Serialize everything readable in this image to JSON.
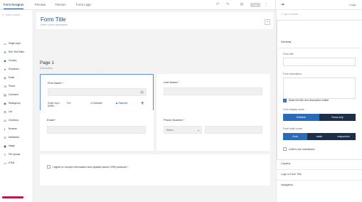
{
  "tabs": [
    {
      "label": "Form Designer",
      "active": true
    },
    {
      "label": "Preview",
      "active": false
    },
    {
      "label": "Themes",
      "active": false
    },
    {
      "label": "Form Logic",
      "active": false
    }
  ],
  "topbar": {
    "undo_icon": "undo-icon",
    "redo_icon": "redo-icon",
    "settings_icon": "gear-icon",
    "save_label": "Save",
    "collapse_icon": "collapse-icon",
    "right_label": "Logic"
  },
  "toolbox": {
    "search_placeholder": "Type to search...",
    "items": [
      {
        "label": "Single-Input",
        "icon": "textbox-icon"
      },
      {
        "label": "Rich Text Editor",
        "icon": "richtext-icon"
      },
      {
        "label": "Country",
        "icon": "globe-icon"
      },
      {
        "label": "Dropdown",
        "icon": "dropdown-icon"
      },
      {
        "label": "Email",
        "icon": "email-icon"
      },
      {
        "label": "Phone",
        "icon": "phone-icon"
      },
      {
        "label": "Comment",
        "icon": "comment-icon"
      },
      {
        "label": "Radiogroup",
        "icon": "radio-icon"
      },
      {
        "label": "List",
        "icon": "list-icon"
      },
      {
        "label": "Checkbox",
        "icon": "checkbox-icon"
      },
      {
        "label": "Boolean",
        "icon": "toggle-icon"
      },
      {
        "label": "Multiselect",
        "icon": "multiselect-icon"
      },
      {
        "label": "Image",
        "icon": "image-icon"
      },
      {
        "label": "File Upload",
        "icon": "upload-icon"
      },
      {
        "label": "HTML",
        "icon": "code-icon"
      }
    ]
  },
  "form": {
    "title": "Form Title",
    "description": "Enter a form description",
    "page_title": "Page 1",
    "page_description": "Description"
  },
  "questions": {
    "first_name": {
      "label": "First Name",
      "required_mark": "*",
      "footer_type": "Single Input",
      "footer_subtype": "Text",
      "duplicate": "Duplicate",
      "required": "Required",
      "delete": "Delete"
    },
    "last_name": {
      "label": "Last Name",
      "required_mark": "*"
    },
    "email": {
      "label": "Email",
      "required_mark": "*"
    },
    "phone": {
      "label": "Phone Number",
      "required_mark": "*",
      "select_placeholder": "Select..."
    },
    "consent": {
      "label": "I agree to receive information and updates about CRM products",
      "required_mark": "*"
    }
  },
  "panel": {
    "search_placeholder": "Type to search...",
    "section_general": "General",
    "form_title_label": "Form title",
    "form_description_label": "Form description",
    "title_visible_label": "Make the title and description visible",
    "display_mode_label": "Form display mode",
    "display_mode_options": [
      "Editable",
      "Read-only"
    ],
    "display_mode_selected": "Editable",
    "width_mode_label": "Form width mode",
    "width_mode_options": [
      "Auto",
      "static",
      "responsive"
    ],
    "width_mode_selected": "Auto",
    "limit_label": "Limit to one submission",
    "sections": [
      "Captcha",
      "Logo in Form Title",
      "Navigation"
    ]
  }
}
